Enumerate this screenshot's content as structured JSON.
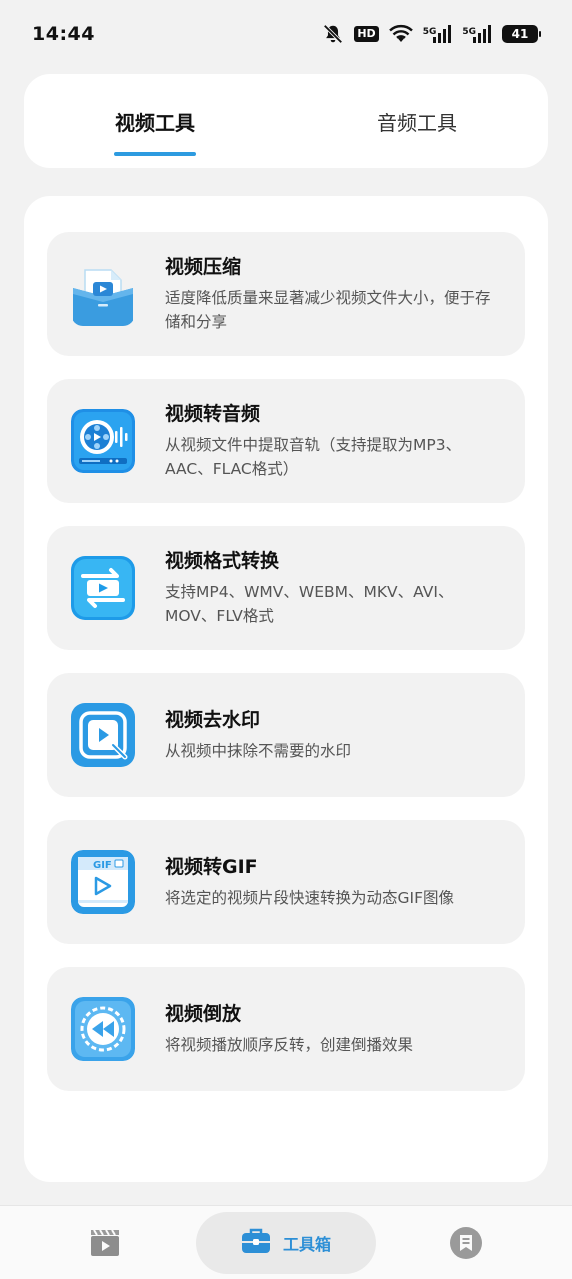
{
  "status_bar": {
    "time": "14:44",
    "hd_label": "HD",
    "network_1": "5G",
    "network_2": "5G",
    "battery": "41",
    "icons": [
      "mute-bell-icon",
      "hd-icon",
      "wifi-icon",
      "signal-icon",
      "signal-icon",
      "battery-icon"
    ]
  },
  "tabs": [
    {
      "label": "视频工具",
      "active": true
    },
    {
      "label": "音频工具",
      "active": false
    }
  ],
  "tools": [
    {
      "title": "视频压缩",
      "desc": "适度降低质量来显著减少视频文件大小，便于存储和分享",
      "icon": "video-compress-icon"
    },
    {
      "title": "视频转音频",
      "desc": "从视频文件中提取音轨（支持提取为MP3、AAC、FLAC格式）",
      "icon": "video-to-audio-icon"
    },
    {
      "title": "视频格式转换",
      "desc": "支持MP4、WMV、WEBM、MKV、AVI、MOV、FLV格式",
      "icon": "video-format-convert-icon"
    },
    {
      "title": "视频去水印",
      "desc": "从视频中抹除不需要的水印",
      "icon": "video-watermark-remove-icon"
    },
    {
      "title": "视频转GIF",
      "desc": "将选定的视频片段快速转换为动态GIF图像",
      "icon": "video-to-gif-icon",
      "icon_text": "GIF"
    },
    {
      "title": "视频倒放",
      "desc": "将视频播放顺序反转，创建倒播效果",
      "icon": "video-reverse-icon"
    }
  ],
  "bottom_nav": {
    "videos_icon": "video-clapper-icon",
    "toolbox_label": "工具箱",
    "toolbox_icon": "toolbox-icon",
    "messages_icon": "message-icon"
  },
  "colors": {
    "accent": "#2d9be0",
    "background": "#f2f2f2",
    "card": "#ffffff"
  }
}
